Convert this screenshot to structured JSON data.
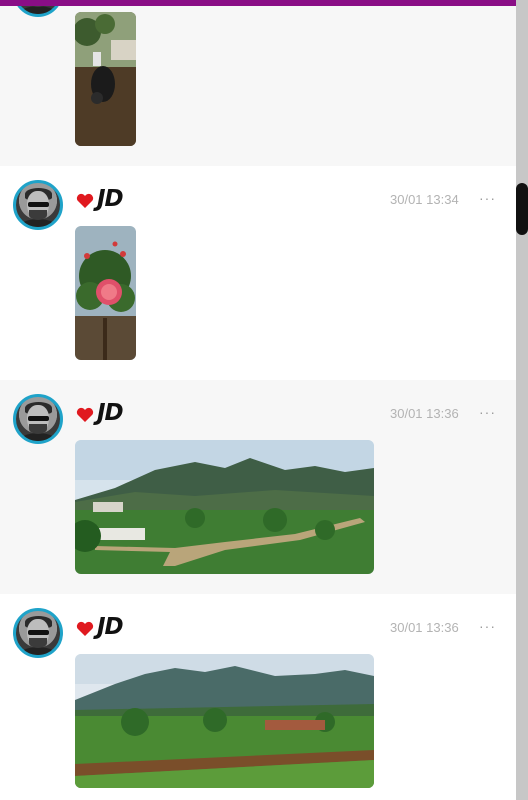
{
  "posts": [
    {
      "name": "",
      "time": "",
      "more": ""
    },
    {
      "name": "JD",
      "time": "30/01 13:34",
      "more": "···"
    },
    {
      "name": "JD",
      "time": "30/01 13:36",
      "more": "···"
    },
    {
      "name": "JD",
      "time": "30/01 13:36",
      "more": "···"
    }
  ],
  "icons": {
    "heart": "heart-icon",
    "more": "more-options-icon",
    "avatar": "avatar"
  },
  "colors": {
    "top_bar": "#8a0e86",
    "avatar_ring": "#1fa3c9",
    "heart": "#e0191f",
    "timestamp": "#b3b3b3"
  }
}
